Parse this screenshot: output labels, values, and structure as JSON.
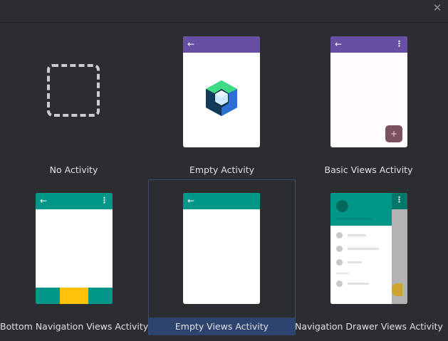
{
  "dialog": {
    "close_glyph": "✕"
  },
  "templates": [
    {
      "label": "No Activity"
    },
    {
      "label": "Empty Activity"
    },
    {
      "label": "Basic Views Activity"
    },
    {
      "label": "Bottom Navigation Views Activity"
    },
    {
      "label": "Empty Views Activity",
      "selected": true
    },
    {
      "label": "Navigation Drawer Views Activity"
    }
  ],
  "glyphs": {
    "back_arrow": "←",
    "more_dots": "⋮",
    "fab_plus": "+"
  },
  "colors": {
    "background": "#2b2d30",
    "selection": "#2e436e",
    "purple_appbar": "#6750a4",
    "teal_appbar": "#009688",
    "fab": "#7d5260",
    "accent_yellow": "#ffc107"
  }
}
